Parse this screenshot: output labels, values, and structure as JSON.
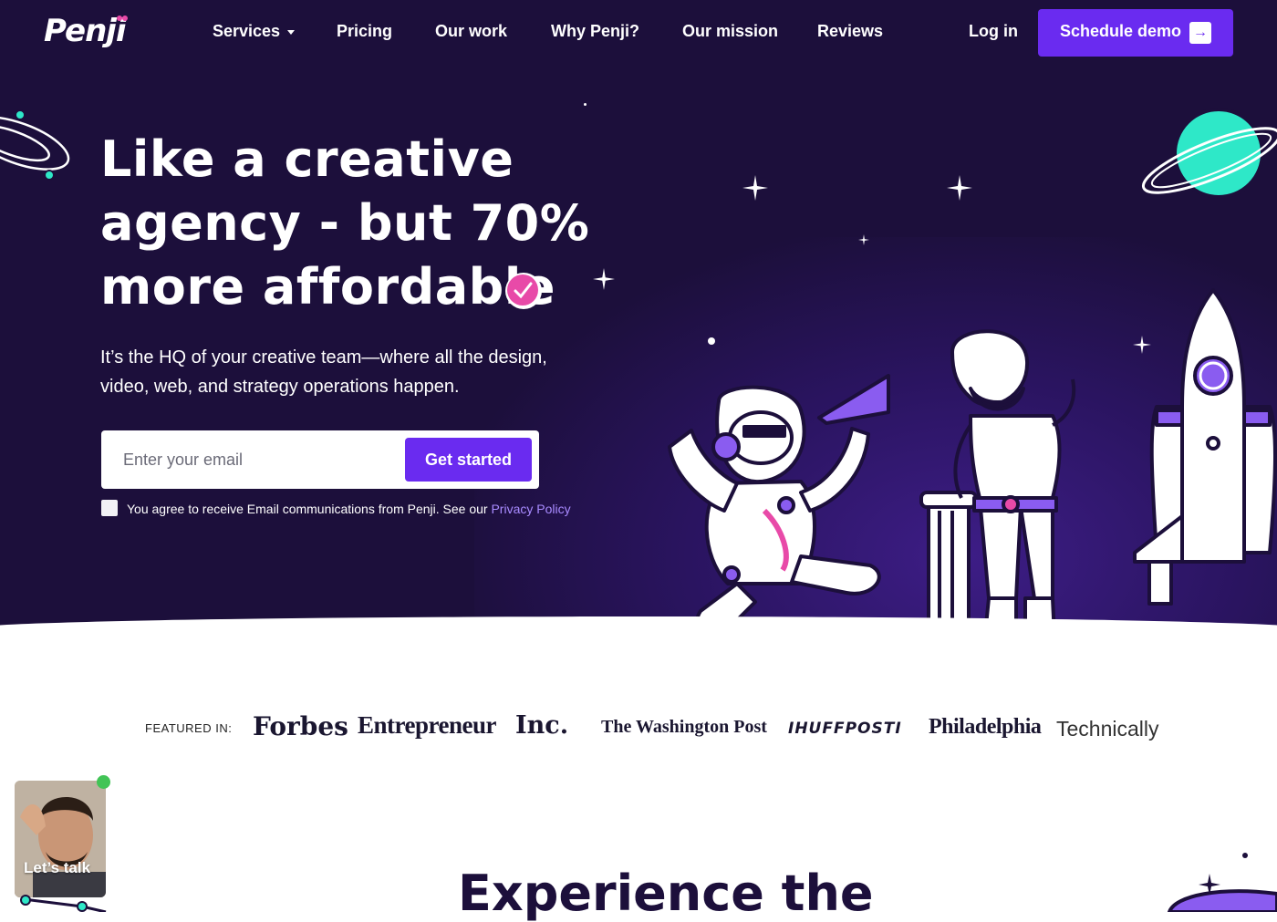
{
  "brand": {
    "name": "Penji"
  },
  "nav": {
    "items": [
      {
        "label": "Services",
        "has_dropdown": true
      },
      {
        "label": "Pricing"
      },
      {
        "label": "Our work"
      },
      {
        "label": "Why Penji?"
      },
      {
        "label": "Our mission"
      },
      {
        "label": "Reviews"
      }
    ],
    "login": "Log in",
    "demo_button": "Schedule demo"
  },
  "hero": {
    "headline_line1": "Like a creative",
    "headline_line2": "agency - but 70%",
    "headline_line3": "more affordable",
    "subcopy": "It’s the HQ of your creative team—where all the design, video, web, and strategy operations happen.",
    "email_placeholder": "Enter your email",
    "cta": "Get started",
    "consent_text": "You agree to receive Email communications from Penji. See our ",
    "privacy_link": "Privacy Policy"
  },
  "featured": {
    "label": "FEATURED IN:",
    "publications": [
      "Forbes",
      "Entrepreneur",
      "Inc.",
      "The Washington Post",
      "IHUFFPOSTI",
      "Philadelphia",
      "Technically"
    ]
  },
  "next_section": {
    "heading": "Experience the"
  },
  "chat_widget": {
    "label": "Let’s talk",
    "status": "online"
  },
  "colors": {
    "hero_bg": "#1c0f3b",
    "accent": "#6a2bf0",
    "link": "#a98bff",
    "teal": "#2ee8c8",
    "pink": "#e84aa8"
  }
}
